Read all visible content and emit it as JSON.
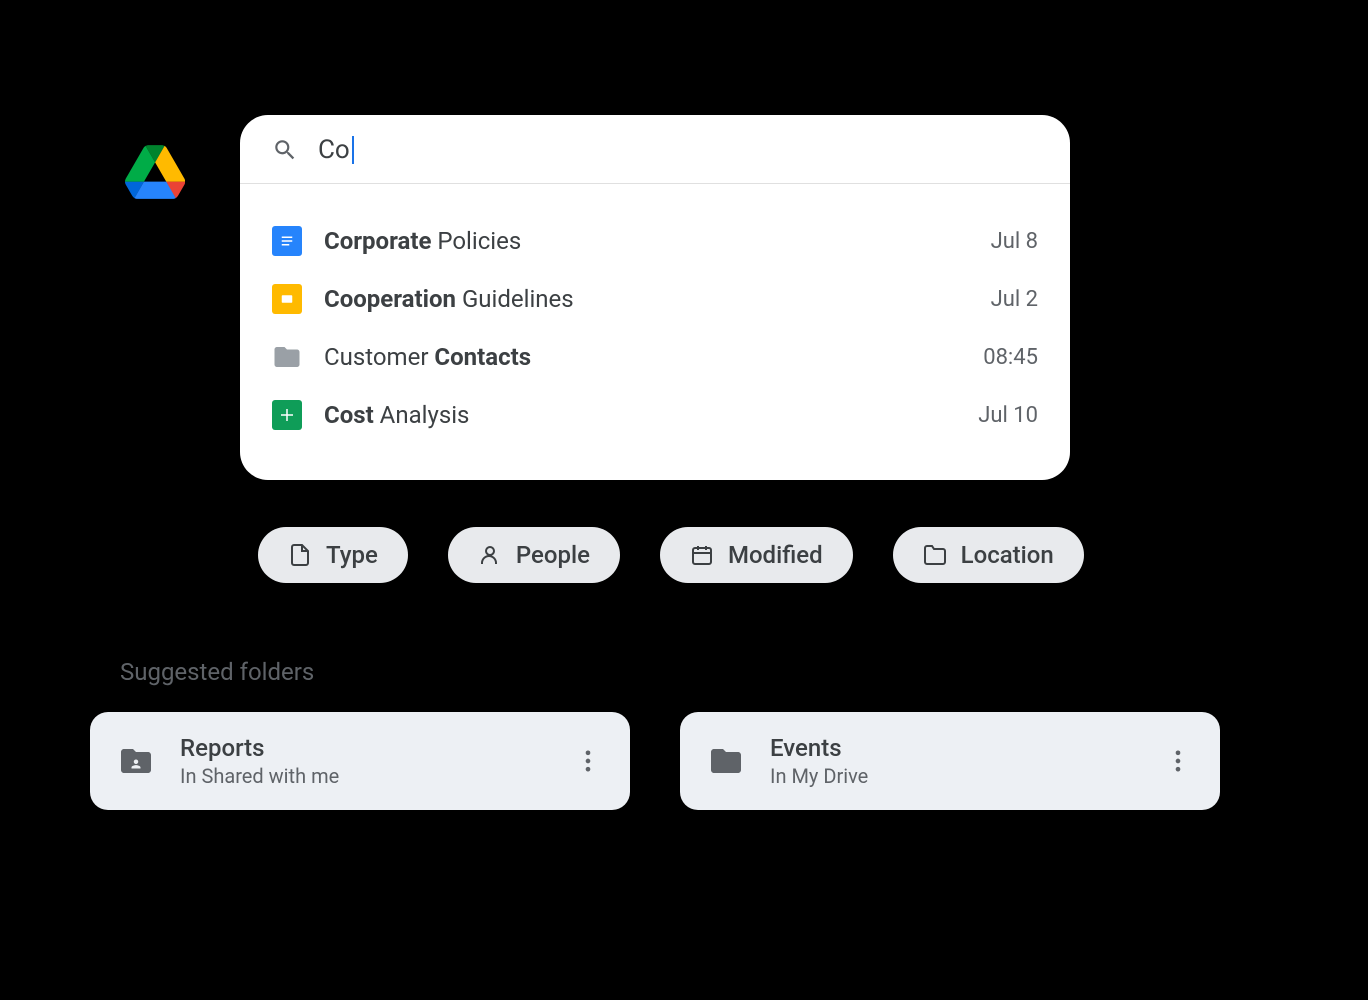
{
  "search": {
    "query": "Co"
  },
  "results": [
    {
      "bold": "Corporate",
      "rest": " Policies",
      "date": "Jul 8",
      "icon": "doc"
    },
    {
      "bold": "Cooperation",
      "rest": " Guidelines",
      "date": "Jul 2",
      "icon": "slides"
    },
    {
      "prefix": "Customer ",
      "bold": "Contacts",
      "date": "08:45",
      "icon": "folder"
    },
    {
      "bold": "Cost",
      "rest": " Analysis",
      "date": "Jul 10",
      "icon": "sheets"
    }
  ],
  "filters": [
    {
      "label": "Type",
      "icon": "file"
    },
    {
      "label": "People",
      "icon": "person"
    },
    {
      "label": "Modified",
      "icon": "calendar"
    },
    {
      "label": "Location",
      "icon": "folder"
    }
  ],
  "suggested": {
    "label": "Suggested folders",
    "folders": [
      {
        "title": "Reports",
        "subtitle": "In Shared with me",
        "icon": "shared-folder"
      },
      {
        "title": "Events",
        "subtitle": "In My Drive",
        "icon": "folder"
      }
    ]
  }
}
